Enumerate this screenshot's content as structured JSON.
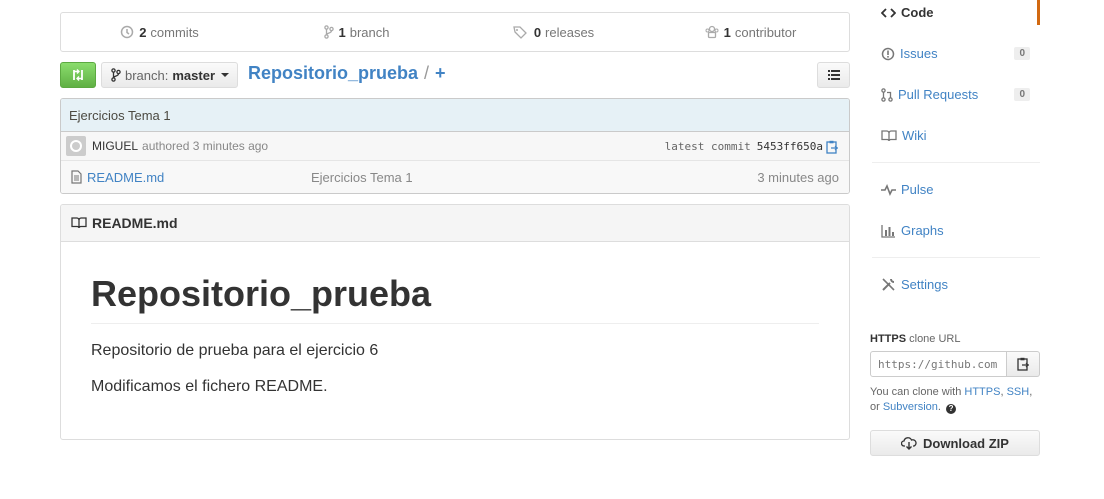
{
  "summary": {
    "commits_count": "2",
    "commits_label": "commits",
    "branches_count": "1",
    "branches_label": "branch",
    "releases_count": "0",
    "releases_label": "releases",
    "contributors_count": "1",
    "contributors_label": "contributor"
  },
  "toolbar": {
    "branch_prefix": "branch:",
    "branch_name": "master",
    "repo_name": "Repositorio_prueba",
    "path_separator": "/",
    "add_file": "+"
  },
  "commit": {
    "title": "Ejercicios Tema 1",
    "author": "MIGUEL",
    "authored_text": "authored 3 minutes ago",
    "latest_label": "latest commit",
    "sha": "5453ff650a"
  },
  "files": [
    {
      "name": "README.md",
      "message": "Ejercicios Tema 1",
      "age": "3 minutes ago"
    }
  ],
  "readme": {
    "header": "README.md",
    "title": "Repositorio_prueba",
    "paragraphs": [
      "Repositorio de prueba para el ejercicio 6",
      "Modificamos el fichero README."
    ]
  },
  "sidebar": {
    "code": "Code",
    "issues": "Issues",
    "issues_count": "0",
    "pulls": "Pull Requests",
    "pulls_count": "0",
    "wiki": "Wiki",
    "pulse": "Pulse",
    "graphs": "Graphs",
    "settings": "Settings"
  },
  "clone": {
    "protocol": "HTTPS",
    "label": "clone URL",
    "url_value": "https://github.com",
    "help_prefix": "You can clone with",
    "https_link": "HTTPS",
    "ssh_link": "SSH",
    "or_text": "or",
    "subversion_link": "Subversion",
    "download_label": "Download ZIP"
  },
  "colors": {
    "link": "#4183c4",
    "compare_green": "#60b044",
    "selected_tab_border": "#d26911",
    "commit_bar": "#e6f1f6"
  }
}
